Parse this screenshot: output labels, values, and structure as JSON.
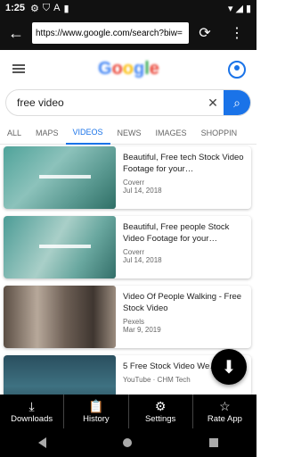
{
  "status": {
    "time": "1:25",
    "icons": [
      "gear-icon",
      "shield-icon",
      "a-icon",
      "sdcard-icon"
    ],
    "right_icons": [
      "wifi-icon",
      "signal-icon",
      "battery-icon"
    ]
  },
  "toolbar": {
    "url": "https://www.google.com/search?biw=",
    "url_underlined_part": "biw",
    "icons": [
      "back-arrow-icon",
      "refresh-icon",
      "more-vert-icon"
    ]
  },
  "google": {
    "logo": "Google",
    "search_query": "free video",
    "tabs": [
      "ALL",
      "MAPS",
      "VIDEOS",
      "NEWS",
      "IMAGES",
      "SHOPPIN"
    ],
    "active_tab": "VIDEOS"
  },
  "results": [
    {
      "title": "Beautiful, Free tech Stock Video Footage for your…",
      "source": "Coverr",
      "date": "Jul 14, 2018"
    },
    {
      "title": "Beautiful, Free people Stock Video Footage for your…",
      "source": "Coverr",
      "date": "Jul 14, 2018"
    },
    {
      "title": "Video Of People Walking - Free Stock Video",
      "source": "Pexels",
      "date": "Mar 9, 2019"
    },
    {
      "title": "5 Free Stock Video We…",
      "source": "YouTube · CHM Tech",
      "date": ""
    }
  ],
  "bottomnav": [
    {
      "label": "Downloads",
      "icon": "download-tray-icon"
    },
    {
      "label": "History",
      "icon": "clipboard-icon"
    },
    {
      "label": "Settings",
      "icon": "gear-icon"
    },
    {
      "label": "Rate App",
      "icon": "star-icon"
    }
  ],
  "colors": {
    "accent": "#1a73e8",
    "toolbar": "#111111",
    "nav": "#000000"
  }
}
